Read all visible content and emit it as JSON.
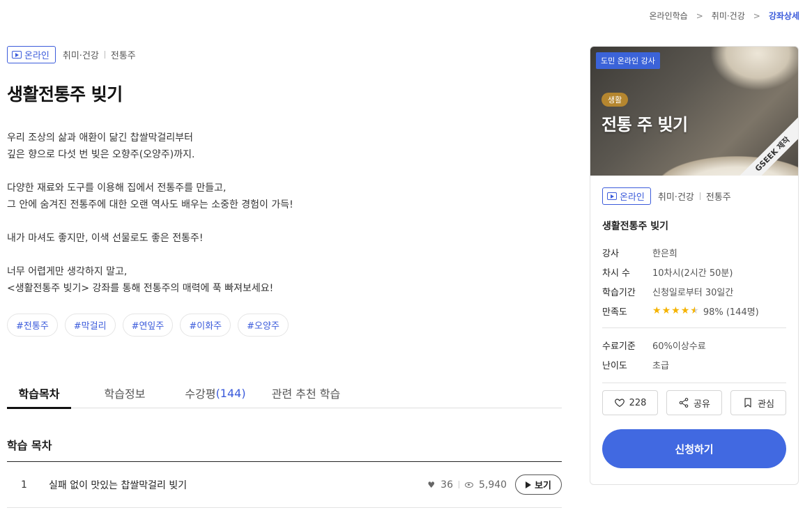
{
  "breadcrumb": {
    "items": [
      "온라인학습",
      "취미·건강",
      "강좌상세"
    ]
  },
  "course": {
    "badge": "온라인",
    "category": "취미·건강",
    "subcategory": "전통주",
    "title": "생활전통주 빚기",
    "description": [
      "우리 조상의 삶과 애환이 닮긴 찹쌀막걸리부터",
      "깊은 향으로 다섯 번 빚은 오향주(오양주)까지.",
      "다양한 재료와 도구를 이용해 집에서 전통주를 만들고,",
      "그 안에 숨겨진 전통주에 대한 오랜 역사도 배우는 소중한 경험이 가득!",
      "내가 마셔도 좋지만, 이색 선물로도 좋은 전통주!",
      "너무 어렵게만 생각하지 말고,",
      "<생활전통주 빚기> 강좌를 통해 전통주의 매력에 푹 빠져보세요!"
    ],
    "tags": [
      "#전통주",
      "#막걸리",
      "#연잎주",
      "#이화주",
      "#오양주"
    ]
  },
  "tabs": [
    {
      "label": "학습목차",
      "active": true
    },
    {
      "label": "학습정보",
      "active": false
    },
    {
      "label": "수강평",
      "count": "(144)",
      "active": false
    },
    {
      "label": "관련 추천 학습",
      "active": false
    }
  ],
  "toc": {
    "title": "학습 목차",
    "rows": [
      {
        "num": "1",
        "name": "실패 없이 맛있는 찹쌀막걸리 빚기",
        "likes": "36",
        "views": "5,940",
        "button": "보기"
      }
    ]
  },
  "card": {
    "thumb_label": "도민 온라인 강사",
    "thumb_pill": "생활",
    "thumb_title": "전통 주 빚기",
    "thumb_ribbon": "GSEEK 제작",
    "badge": "온라인",
    "category": "취미·건강",
    "subcategory": "전통주",
    "title": "생활전통주 빚기",
    "info": [
      {
        "key": "강사",
        "value": "한은희"
      },
      {
        "key": "차시 수",
        "value": "10차시(2시간 50분)"
      },
      {
        "key": "학습기간",
        "value": "신청일로부터 30일간"
      }
    ],
    "rating": {
      "key": "만족도",
      "stars": 4.5,
      "text": "98% (144명)"
    },
    "info2": [
      {
        "key": "수료기준",
        "value": "60%이상수료"
      },
      {
        "key": "난이도",
        "value": "초급"
      }
    ],
    "actions": {
      "like_count": "228",
      "share": "공유",
      "bookmark": "관심"
    },
    "apply": "신청하기"
  },
  "colors": {
    "accent": "#4169e1",
    "link": "#3b5bdb",
    "star": "#f5b301"
  }
}
